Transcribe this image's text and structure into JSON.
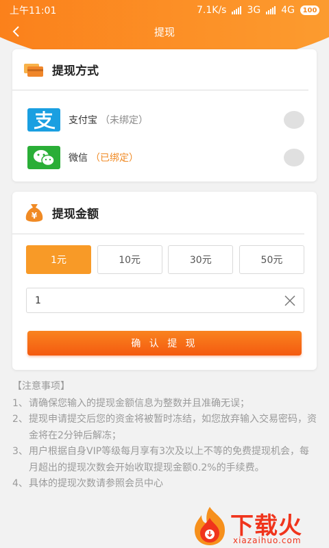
{
  "status_bar": {
    "time": "上午11:01",
    "speed": "7.1K/s",
    "network1": "3G",
    "network2": "4G",
    "battery": "100"
  },
  "nav": {
    "title": "提现"
  },
  "method_card": {
    "title": "提现方式",
    "options": [
      {
        "name": "支付宝",
        "status": "（未绑定）",
        "status_color": "#8a8a8a",
        "icon": "alipay-icon"
      },
      {
        "name": "微信",
        "status": "（已绑定）",
        "status_color": "#f08a24",
        "icon": "wechat-icon"
      }
    ]
  },
  "amount_card": {
    "title": "提现金额",
    "options": [
      "1元",
      "10元",
      "30元",
      "50元"
    ],
    "selected_index": 0,
    "input_value": "1",
    "confirm_label": "确 认 提 现"
  },
  "notes": {
    "title": "【注意事项】",
    "items": [
      {
        "num": "1、",
        "text": "请确保您输入的提现金额信息为整数并且准确无误；"
      },
      {
        "num": "2、",
        "text": "提现申请提交后您的资金将被暂时冻结，如您放弃输入交易密码，资金将在2分钟后解冻；"
      },
      {
        "num": "3、",
        "text": "用户根据自身VIP等级每月享有3次及以上不等的免费提现机会，每月超出的提现次数会开始收取提现金额0.2%的手续费。"
      },
      {
        "num": "4、",
        "text": "具体的提现次数请参照会员中心"
      }
    ]
  },
  "watermark": {
    "brand": "下载火",
    "url": "xiazaihuo.com"
  },
  "colors": {
    "accent": "#f89a27",
    "header": "#fb7a16",
    "alipay": "#1a9fe1",
    "wechat": "#2aae37"
  }
}
